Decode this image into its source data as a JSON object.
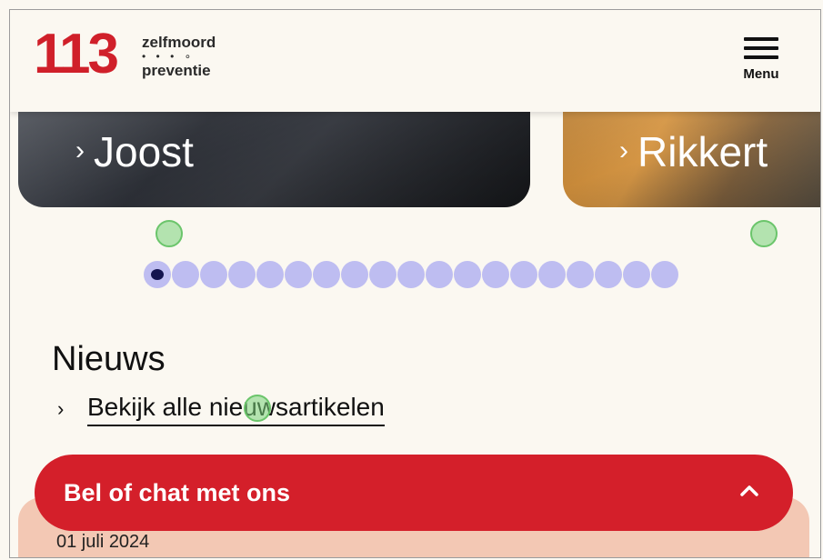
{
  "header": {
    "logo_number": "113",
    "logo_top": "zelfmoord",
    "logo_dots": "• • • ∘",
    "logo_bottom": "preventie",
    "menu_label": "Menu"
  },
  "carousel": {
    "cards": [
      {
        "name": "Joost"
      },
      {
        "name": "Rikkert"
      }
    ],
    "page_count": 19,
    "active_page": 1
  },
  "news": {
    "title": "Nieuws",
    "link_label": "Bekijk alle nieuwsartikelen"
  },
  "cta": {
    "label": "Bel of chat met ons"
  },
  "article": {
    "date": "01 juli 2024"
  },
  "colors": {
    "brand_red": "#d41f2a",
    "background": "#fbf8f1"
  }
}
